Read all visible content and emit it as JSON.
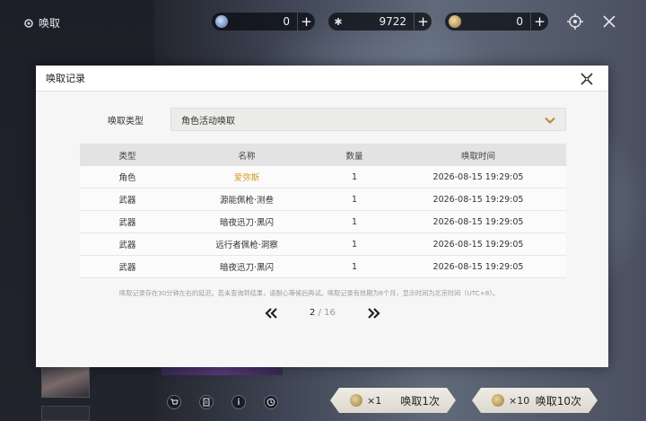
{
  "top_bar": {
    "title": "唤取",
    "currencies": [
      {
        "icon": "lunite-icon",
        "value": "0"
      },
      {
        "icon": "astrite-icon",
        "value": "9722"
      },
      {
        "icon": "tide-icon",
        "value": "0"
      }
    ]
  },
  "modal": {
    "title": "唤取记录",
    "filter_label": "唤取类型",
    "filter_value": "角色活动唤取",
    "columns": [
      "类型",
      "名称",
      "数量",
      "唤取时间"
    ],
    "rows": [
      {
        "type": "角色",
        "name": "爱弥斯",
        "qty": "1",
        "time": "2026-08-15 19:29:05",
        "highlight": "#d49a2a"
      },
      {
        "type": "武器",
        "name": "源能佩枪·测叁",
        "qty": "1",
        "time": "2026-08-15 19:29:05"
      },
      {
        "type": "武器",
        "name": "暗夜迅刀·黑闪",
        "qty": "1",
        "time": "2026-08-15 19:29:05"
      },
      {
        "type": "武器",
        "name": "远行者佩枪·洞察",
        "qty": "1",
        "time": "2026-08-15 19:29:05"
      },
      {
        "type": "武器",
        "name": "暗夜迅刀·黑闪",
        "qty": "1",
        "time": "2026-08-15 19:29:05"
      }
    ],
    "note": "唤取记录存在30分钟左右的延迟。若未查询到结果，请耐心等候后再试。唤取记录有效期为6个月，显示时间为北京时间（UTC+8）。",
    "pager": {
      "current": "2",
      "separator": "/",
      "total": "16"
    }
  },
  "bottom_bar": {
    "summon_one": {
      "count": "×1",
      "label": "唤取1次"
    },
    "summon_ten": {
      "count": "×10",
      "label": "唤取10次"
    }
  }
}
